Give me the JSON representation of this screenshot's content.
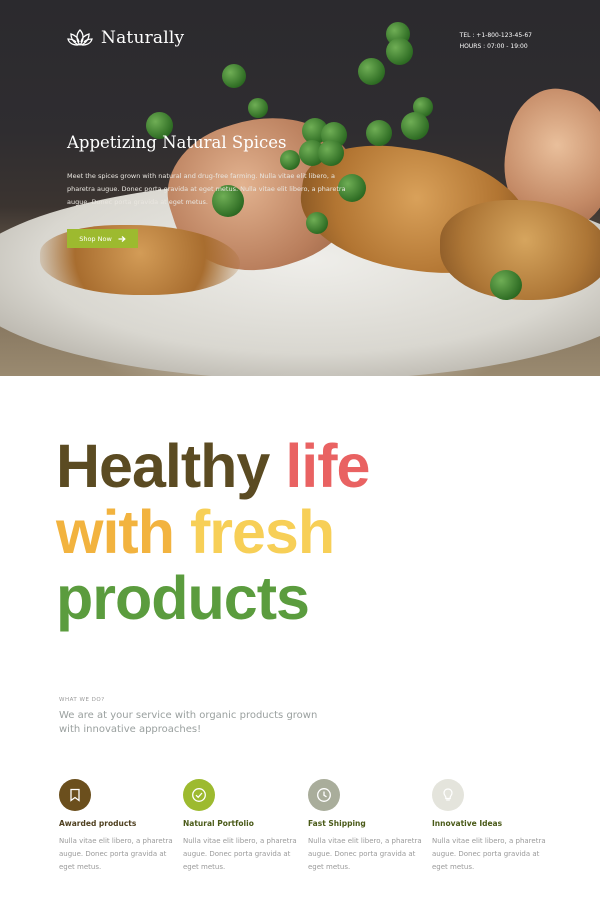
{
  "brand": {
    "name": "Naturally",
    "logo_icon": "lotus-icon"
  },
  "contact": {
    "tel": "TEL : +1-800-123-45-67",
    "hours": "HOURS : 07:00 - 19:00"
  },
  "hero": {
    "title": "Appetizing Natural Spices",
    "text": "Meet the spices grown with natural and drug-free farming. Nulla vitae elit libero, a pharetra augue. Donec porta gravida at eget metus. Nulla vitae elit libero, a pharetra augue. Donec porta gravida at eget metus.",
    "button_label": "Shop Now",
    "button_icon": "arrow-right-icon"
  },
  "headline": {
    "line1": [
      "Healthy",
      "life"
    ],
    "line2": [
      "with",
      "fresh"
    ],
    "line3": "products"
  },
  "services": {
    "eyebrow": "WHAT WE DO?",
    "intro": "We are at your service with organic products grown with innovative approaches!",
    "features": [
      {
        "title": "Awarded products",
        "text": "Nulla vitae elit libero, a pharetra augue. Donec porta gravida at eget metus.",
        "icon": "bookmark-icon",
        "color": "#6b4f1d"
      },
      {
        "title": "Natural Portfolio",
        "text": "Nulla vitae elit libero, a pharetra augue. Donec porta gravida at eget metus.",
        "icon": "check-circle-icon",
        "color": "#9dba2f"
      },
      {
        "title": "Fast Shipping",
        "text": "Nulla vitae elit libero, a pharetra augue. Donec porta gravida at eget metus.",
        "icon": "clock-icon",
        "color": "#a9ad9b"
      },
      {
        "title": "Innovative Ideas",
        "text": "Nulla vitae elit libero, a pharetra augue. Donec porta gravida at eget metus.",
        "icon": "lightbulb-icon",
        "color": "#e4e4dc"
      }
    ]
  },
  "colors": {
    "accent_green": "#9dba2f",
    "brown": "#5b4b22",
    "red": "#e96262",
    "orange": "#f2b33f",
    "yellow": "#f7cf57",
    "green": "#5b9c3e"
  }
}
